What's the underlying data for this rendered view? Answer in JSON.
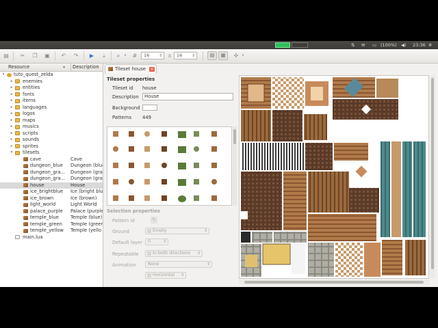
{
  "system_tray": {
    "battery": "(100%)",
    "time": "23:36"
  },
  "toolbar": {
    "grid_width": "16",
    "grid_height": "16",
    "grid_separator": "x"
  },
  "tree": {
    "header_resource": "Resource",
    "header_description": "Description",
    "project": "tuto_quest_zelda",
    "folders": [
      "enemies",
      "entities",
      "fonts",
      "items",
      "languages",
      "logos",
      "maps",
      "musics",
      "scripts",
      "sounds",
      "sprites"
    ],
    "tilesets_folder": "tilesets",
    "tilesets": [
      {
        "name": "cave",
        "desc": "Cave"
      },
      {
        "name": "dungeon_blue",
        "desc": "Dungeon (blue)"
      },
      {
        "name": "dungeon_gra...",
        "desc": "Dungeon (gra"
      },
      {
        "name": "dungeon_gra...",
        "desc": "Dungeon (gra"
      },
      {
        "name": "house",
        "desc": "House",
        "selected": true
      },
      {
        "name": "ice_brightblue",
        "desc": "Ice (bright blu"
      },
      {
        "name": "ice_brown",
        "desc": "Ice (brown)"
      },
      {
        "name": "light_world",
        "desc": "Light World"
      },
      {
        "name": "palace_purple",
        "desc": "Palace (purple"
      },
      {
        "name": "temple_blue",
        "desc": "Temple (blue)"
      },
      {
        "name": "temple_green",
        "desc": "Temple (green"
      },
      {
        "name": "temple_yellow",
        "desc": "Temple (yello"
      }
    ],
    "main_file": "main.lua"
  },
  "tab": {
    "label": "Tileset house"
  },
  "properties": {
    "title": "Tileset properties",
    "id_label": "Tileset id",
    "id_value": "house",
    "desc_label": "Description",
    "desc_value": "House",
    "bg_label": "Background",
    "bg_color": "#ffffff",
    "patterns_label": "Patterns",
    "patterns_value": "449"
  },
  "selection": {
    "title": "Selection properties",
    "pattern_id_label": "Pattern id",
    "ground_label": "Ground",
    "ground_value": "Empty",
    "layer_label": "Default layer",
    "layer_value": "0",
    "repeatable_label": "Repeatable",
    "repeatable_value": "In both directions",
    "animation_label": "Animation",
    "animation_value": "None",
    "anim_dir_value": "Horizontal"
  },
  "colors": {
    "accent_green": "#2fbf5a",
    "panel_dark": "#3c3b37",
    "tab_close": "#e4654c"
  }
}
